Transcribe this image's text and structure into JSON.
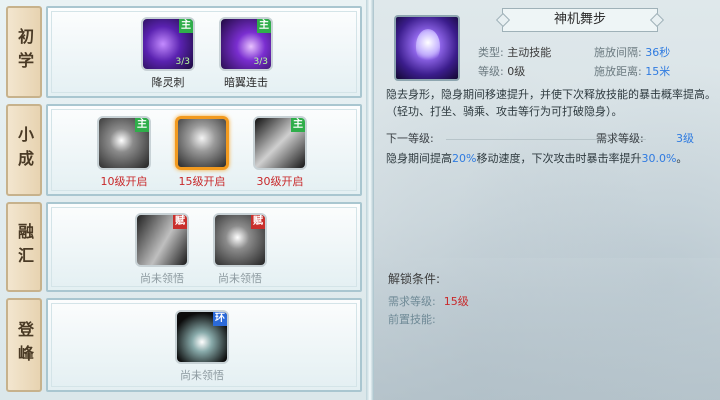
{
  "tiers": [
    {
      "label": "初学"
    },
    {
      "label": "小成"
    },
    {
      "label": "融汇"
    },
    {
      "label": "登峰"
    }
  ],
  "skills": {
    "s1": {
      "name": "降灵刺",
      "tag": "主",
      "count": "3/3"
    },
    "s2": {
      "name": "暗翼连击",
      "tag": "主",
      "count": "3/3"
    },
    "s3": {
      "name": "10级开启",
      "tag": "主"
    },
    "s4": {
      "name": "15级开启"
    },
    "s5": {
      "name": "30级开启",
      "tag": "主"
    },
    "s6": {
      "name": "尚未领悟",
      "tag": "赋"
    },
    "s7": {
      "name": "尚未领悟",
      "tag": "赋"
    },
    "s8": {
      "name": "尚未领悟",
      "tag": "环"
    }
  },
  "detail": {
    "title": "神机舞步",
    "type_label": "类型:",
    "type_value": "主动技能",
    "level_label": "等级:",
    "level_value": "0级",
    "interval_label": "施放间隔:",
    "interval_value": "36秒",
    "range_label": "施放距离:",
    "range_value": "15米",
    "description": "隐去身形，隐身期间移速提升，并使下次释放技能的暴击概率提高。（轻功、打坐、骑乘、攻击等行为可打破隐身）。",
    "next_label": "下一等级:",
    "need_label": "需求等级:",
    "need_value": "3级",
    "next_desc_1": "隐身期间提高",
    "next_desc_hl1": "20%",
    "next_desc_2": "移动速度，下次攻击时暴击率提升",
    "next_desc_hl2": "30.0%",
    "next_desc_3": "。"
  },
  "unlock": {
    "title": "解锁条件:",
    "level_label": "需求等级:",
    "level_value": "15级",
    "prereq_label": "前置技能:"
  },
  "colors": {
    "accent_blue": "#2f7be0",
    "locked_red": "#c8282a",
    "selected_orange": "#f29a1f"
  }
}
